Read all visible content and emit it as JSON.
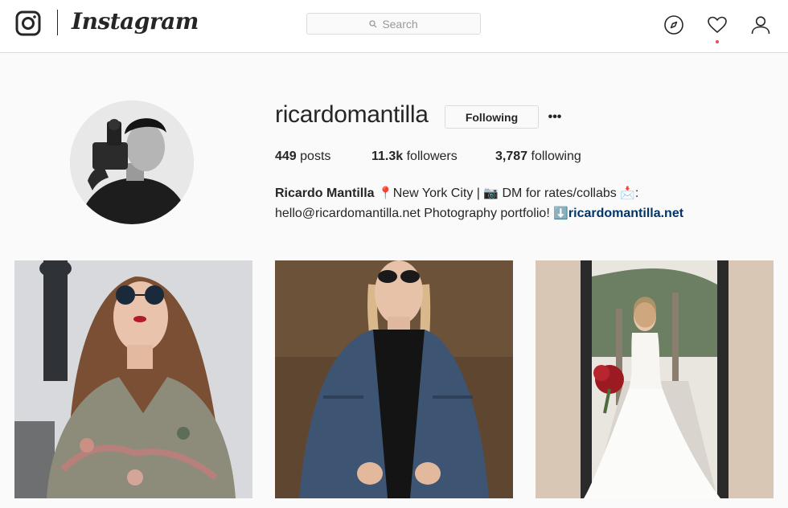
{
  "app": {
    "wordmark": "Instagram"
  },
  "search": {
    "placeholder": "Search"
  },
  "nav": {
    "icons": [
      "compass-icon",
      "heart-icon",
      "person-icon"
    ],
    "has_notification": true
  },
  "profile": {
    "username": "ricardomantilla",
    "follow_button_label": "Following",
    "more_label": "•••",
    "stats": {
      "posts_count": "449",
      "posts_label": "posts",
      "followers_count": "11.3k",
      "followers_label": "followers",
      "following_count": "3,787",
      "following_label": "following"
    },
    "bio": {
      "full_name": "Ricardo Mantilla",
      "pin_emoji": "📍",
      "location": "New York City | ",
      "camera_emoji": "📷",
      "dm_text": " DM for rates/collabs ",
      "mail_emoji": "📩",
      "colon": ":",
      "email_text": "hello@ricardomantilla.net Photography portfolio! ",
      "arrow_emoji": "⬇️",
      "website": "ricardomantilla.net"
    }
  },
  "posts": [
    {
      "label": "post-1"
    },
    {
      "label": "post-2"
    },
    {
      "label": "post-3"
    }
  ],
  "colors": {
    "background": "#fafafa",
    "text": "#262626",
    "border": "#dbdbdb",
    "link": "#003569",
    "notification": "#ed4956"
  }
}
